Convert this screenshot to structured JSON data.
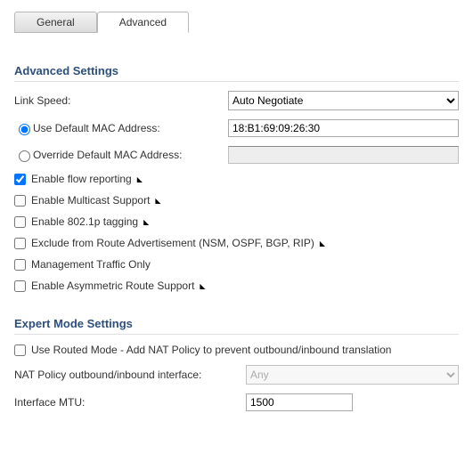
{
  "tabs": {
    "general": "General",
    "advanced": "Advanced"
  },
  "sections": {
    "advanced_title": "Advanced Settings",
    "expert_title": "Expert Mode Settings"
  },
  "link_speed": {
    "label": "Link Speed:",
    "value": "Auto Negotiate"
  },
  "mac": {
    "use_default_label": "Use Default MAC Address:",
    "default_value": "18:B1:69:09:26:30",
    "override_label": "Override Default MAC Address:",
    "override_value": ""
  },
  "checks": {
    "flow": "Enable flow reporting",
    "multicast": "Enable Multicast Support",
    "dot1p": "Enable 802.1p tagging",
    "exclude_route": "Exclude from Route Advertisement (NSM, OSPF, BGP, RIP)",
    "mgmt_only": "Management Traffic Only",
    "asym_route": "Enable Asymmetric Route Support"
  },
  "expert": {
    "routed_mode": "Use Routed Mode - Add NAT Policy to prevent outbound/inbound translation",
    "nat_policy_label": "NAT Policy outbound/inbound interface:",
    "nat_policy_value": "Any",
    "mtu_label": "Interface MTU:",
    "mtu_value": "1500"
  },
  "marker": "◣"
}
